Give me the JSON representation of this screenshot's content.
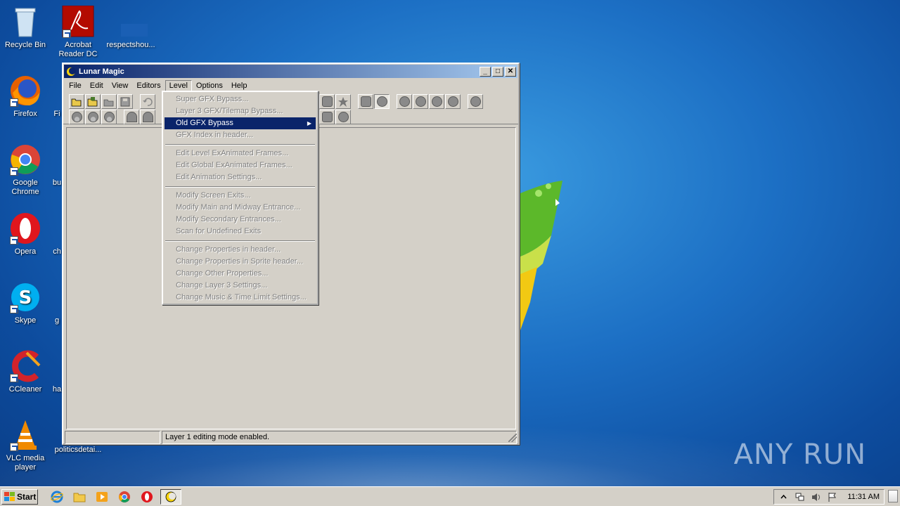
{
  "desktop": {
    "icons": [
      {
        "label": "Recycle Bin",
        "icon": "recycle-bin-icon"
      },
      {
        "label": "Acrobat Reader DC",
        "icon": "acrobat-icon"
      },
      {
        "label": "respectshou...",
        "icon": "document-icon"
      },
      {
        "label": "Firefox",
        "icon": "firefox-icon"
      },
      {
        "label": "Google Chrome",
        "icon": "chrome-icon"
      },
      {
        "label": "Opera",
        "icon": "opera-icon"
      },
      {
        "label": "Skype",
        "icon": "skype-icon"
      },
      {
        "label": "CCleaner",
        "icon": "ccleaner-icon"
      },
      {
        "label": "VLC media player",
        "icon": "vlc-icon"
      },
      {
        "label": "politicsdetai...",
        "icon": "document-icon"
      }
    ],
    "partial_labels": [
      "Fi",
      "bu",
      "ch",
      "g",
      "ha"
    ],
    "watermark": "ANY RUN"
  },
  "window": {
    "title": "Lunar Magic",
    "menu": [
      "File",
      "Edit",
      "View",
      "Editors",
      "Level",
      "Options",
      "Help"
    ],
    "open_menu": "Level",
    "status": {
      "left": "",
      "message": "Layer 1 editing mode enabled."
    }
  },
  "level_menu": {
    "groups": [
      [
        {
          "label": "Super GFX Bypass...",
          "enabled": false
        },
        {
          "label": "Layer 3 GFX/Tilemap Bypass...",
          "enabled": false
        },
        {
          "label": "Old GFX Bypass",
          "enabled": true,
          "highlighted": true,
          "submenu": true
        },
        {
          "label": "GFX Index in header...",
          "enabled": false
        }
      ],
      [
        {
          "label": "Edit Level ExAnimated Frames...",
          "enabled": false
        },
        {
          "label": "Edit Global ExAnimated Frames...",
          "enabled": false
        },
        {
          "label": "Edit Animation Settings...",
          "enabled": false
        }
      ],
      [
        {
          "label": "Modify Screen Exits...",
          "enabled": false
        },
        {
          "label": "Modify Main and Midway Entrance...",
          "enabled": false
        },
        {
          "label": "Modify Secondary Entrances...",
          "enabled": false
        },
        {
          "label": "Scan for Undefined Exits",
          "enabled": false
        }
      ],
      [
        {
          "label": "Change Properties in header...",
          "enabled": false
        },
        {
          "label": "Change Properties in Sprite header...",
          "enabled": false
        },
        {
          "label": "Change Other Properties...",
          "enabled": false
        },
        {
          "label": "Change Layer 3 Settings...",
          "enabled": false
        },
        {
          "label": "Change Music & Time Limit Settings...",
          "enabled": false
        }
      ]
    ]
  },
  "taskbar": {
    "start_label": "Start",
    "quick_launch": [
      "ie-icon",
      "explorer-icon",
      "media-player-icon",
      "chrome-icon",
      "opera-icon",
      "lunar-magic-icon"
    ],
    "clock": "11:31 AM"
  },
  "colors": {
    "highlight": "#0a246a",
    "face": "#d4d0c8",
    "disabled_text": "#808080"
  }
}
